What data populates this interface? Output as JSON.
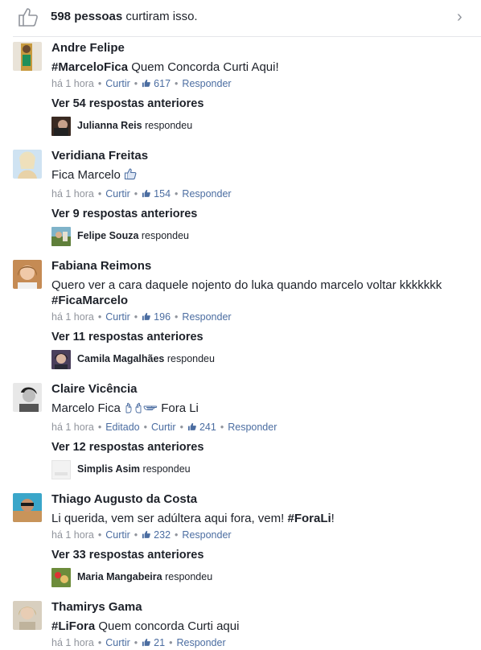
{
  "likes_bar": {
    "count": "598 pessoas",
    "suffix": "curtiram isso."
  },
  "comments": [
    {
      "author": "Andre Felipe",
      "hashtag": "#MarceloFica",
      "text": " Quem Concorda Curti Aqui!",
      "time": "há 1 hora",
      "like": "Curtir",
      "likes": "617",
      "reply": "Responder",
      "more": "Ver 54 respostas anteriores",
      "replier": "Julianna Reis",
      "replied": "respondeu"
    },
    {
      "author": "Veridiana Freitas",
      "text": "Fica Marcelo",
      "time": "há 1 hora",
      "like": "Curtir",
      "likes": "154",
      "reply": "Responder",
      "more": "Ver 9 respostas anteriores",
      "replier": "Felipe Souza",
      "replied": "respondeu"
    },
    {
      "author": "Fabiana Reimons",
      "text": "Quero ver a cara daquele nojento do luka quando marcelo voltar kkkkkkk",
      "hashtag": "#FicaMarcelo",
      "time": "há 1 hora",
      "like": "Curtir",
      "likes": "196",
      "reply": "Responder",
      "more": "Ver 11 respostas anteriores",
      "replier": "Camila Magalhães",
      "replied": "respondeu"
    },
    {
      "author": "Claire Vicência",
      "text": "Marcelo Fica",
      "text2": "Fora Li",
      "time": "há 1 hora",
      "edited": "Editado",
      "like": "Curtir",
      "likes": "241",
      "reply": "Responder",
      "more": "Ver 12 respostas anteriores",
      "replier": "Simplis Asim",
      "replied": "respondeu"
    },
    {
      "author": "Thiago Augusto da Costa",
      "text": "Li querida, vem ser adúltera aqui fora, vem! ",
      "hashtag": "#ForaLi",
      "text2": "!",
      "time": "há 1 hora",
      "like": "Curtir",
      "likes": "232",
      "reply": "Responder",
      "more": "Ver 33 respostas anteriores",
      "replier": "Maria Mangabeira",
      "replied": "respondeu"
    },
    {
      "author": "Thamirys Gama",
      "hashtag": "#LiFora",
      "text": " Quem concorda Curti aqui",
      "time": "há 1 hora",
      "like": "Curtir",
      "likes": "21",
      "reply": "Responder"
    }
  ],
  "colors": {
    "link": "#4b6da1",
    "meta": "#90949c",
    "text": "#1d2129",
    "divider": "#e5e6e9"
  },
  "icons": [
    "thumbs-up-icon",
    "chevron-right-icon",
    "pointing-hand-icon"
  ]
}
